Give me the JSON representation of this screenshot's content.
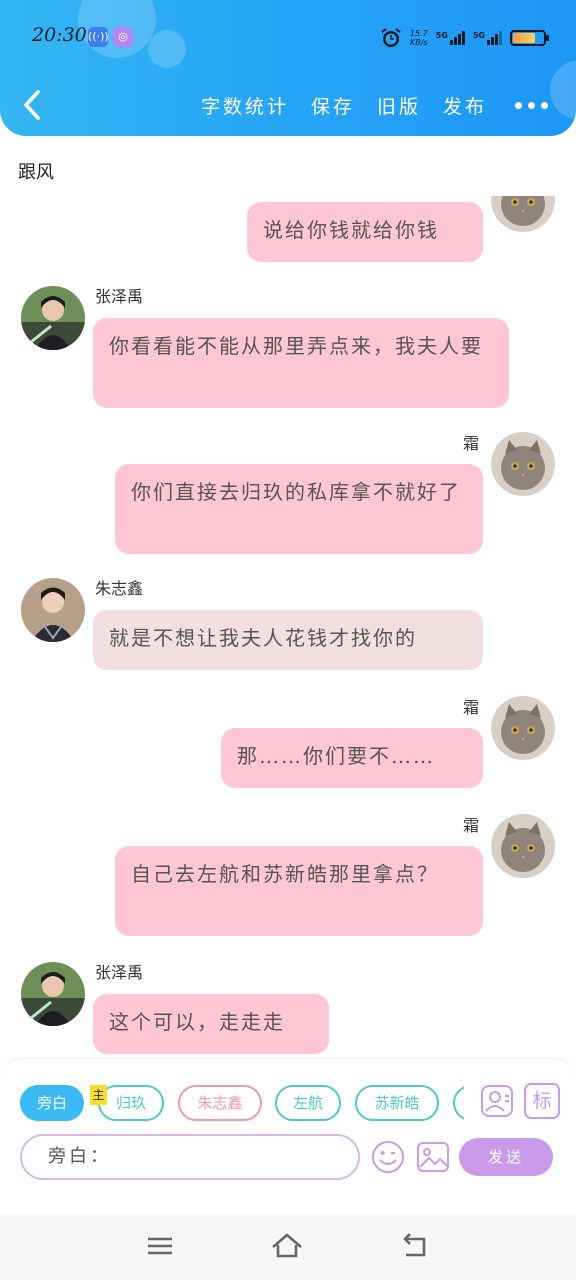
{
  "status_bar": {
    "time": "20:30",
    "net_speed_value": "15.7",
    "net_speed_unit": "KB/s",
    "sim1": "5G",
    "sim2": "5G",
    "battery_level": 0.72
  },
  "header": {
    "back_icon": "chevron-left-icon",
    "actions": [
      "字数统计",
      "保存",
      "旧版",
      "发布"
    ],
    "more_icon": "more-dots-icon"
  },
  "chat": {
    "title": "跟风",
    "messages": [
      {
        "side": "right",
        "sender": "",
        "avatar": "cat-avatar",
        "text": "说给你钱就给你钱",
        "color": "#ffc6d3"
      },
      {
        "side": "left",
        "sender": "张泽禹",
        "avatar": "person-avatar-green",
        "text": "你看看能不能从那里弄点来，我夫人要",
        "color": "#ffc6d3"
      },
      {
        "side": "right",
        "sender": "霜",
        "avatar": "cat-avatar",
        "text": "你们直接去归玖的私库拿不就好了",
        "color": "#ffc6d3"
      },
      {
        "side": "left",
        "sender": "朱志鑫",
        "avatar": "person-avatar-dark",
        "text": "就是不想让我夫人花钱才找你的",
        "color": "#f2dfe0"
      },
      {
        "side": "right",
        "sender": "霜",
        "avatar": "cat-avatar",
        "text": "那……你们要不……",
        "color": "#ffc6d3"
      },
      {
        "side": "right",
        "sender": "霜",
        "avatar": "cat-avatar",
        "text": "自己去左航和苏新皓那里拿点？",
        "color": "#ffc6d3"
      },
      {
        "side": "left",
        "sender": "张泽禹",
        "avatar": "person-avatar-green",
        "text": "这个可以，走走走",
        "color": "#ffc6d3"
      }
    ]
  },
  "composer": {
    "roles": [
      {
        "label": "旁白",
        "color": "#3ab9f2",
        "active": true
      },
      {
        "label": "归玖",
        "color": "#4fc9c4",
        "active": false
      },
      {
        "label": "朱志鑫",
        "color": "#f29aa2",
        "active": false
      },
      {
        "label": "左航",
        "color": "#4fc9c4",
        "active": false
      },
      {
        "label": "苏新皓",
        "color": "#4fc9c4",
        "active": false
      },
      {
        "label": "",
        "color": "#4fc9c4",
        "active": false
      }
    ],
    "main_tag": "主",
    "role_icon": "person-card-icon",
    "mark_icon_label": "标",
    "input_value": "旁白：",
    "emoji_icon": "emoji-icon",
    "image_icon": "image-icon",
    "send_label": "发送"
  },
  "system_nav": {
    "menu_icon": "menu-icon",
    "home_icon": "home-icon",
    "back_icon": "back-arrow-icon"
  }
}
